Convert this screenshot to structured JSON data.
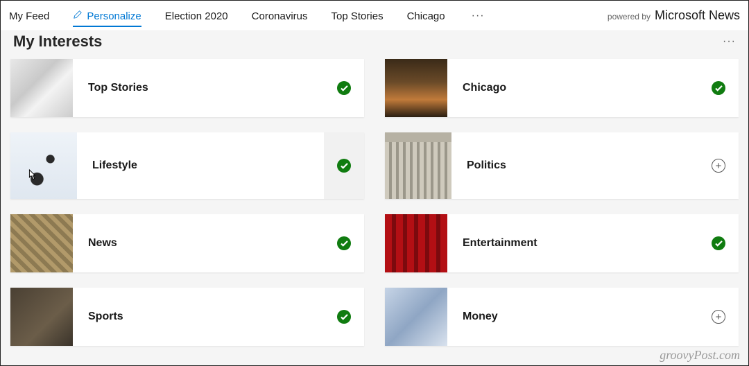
{
  "nav": {
    "items": [
      {
        "label": "My Feed"
      },
      {
        "label": "Personalize"
      },
      {
        "label": "Election 2020"
      },
      {
        "label": "Coronavirus"
      },
      {
        "label": "Top Stories"
      },
      {
        "label": "Chicago"
      }
    ],
    "more": "···",
    "powered_prefix": "powered by",
    "powered_brand": "Microsoft News"
  },
  "page": {
    "title": "My Interests",
    "more": "···"
  },
  "interests": {
    "left": [
      {
        "label": "Top Stories",
        "state": "checked"
      },
      {
        "label": "Lifestyle",
        "state": "checked"
      },
      {
        "label": "News",
        "state": "checked"
      },
      {
        "label": "Sports",
        "state": "checked"
      }
    ],
    "right": [
      {
        "label": "Chicago",
        "state": "checked"
      },
      {
        "label": "Politics",
        "state": "add"
      },
      {
        "label": "Entertainment",
        "state": "checked"
      },
      {
        "label": "Money",
        "state": "add"
      }
    ]
  },
  "watermark": "groovyPost.com",
  "colors": {
    "accent": "#0078d4",
    "check": "#107c10"
  }
}
